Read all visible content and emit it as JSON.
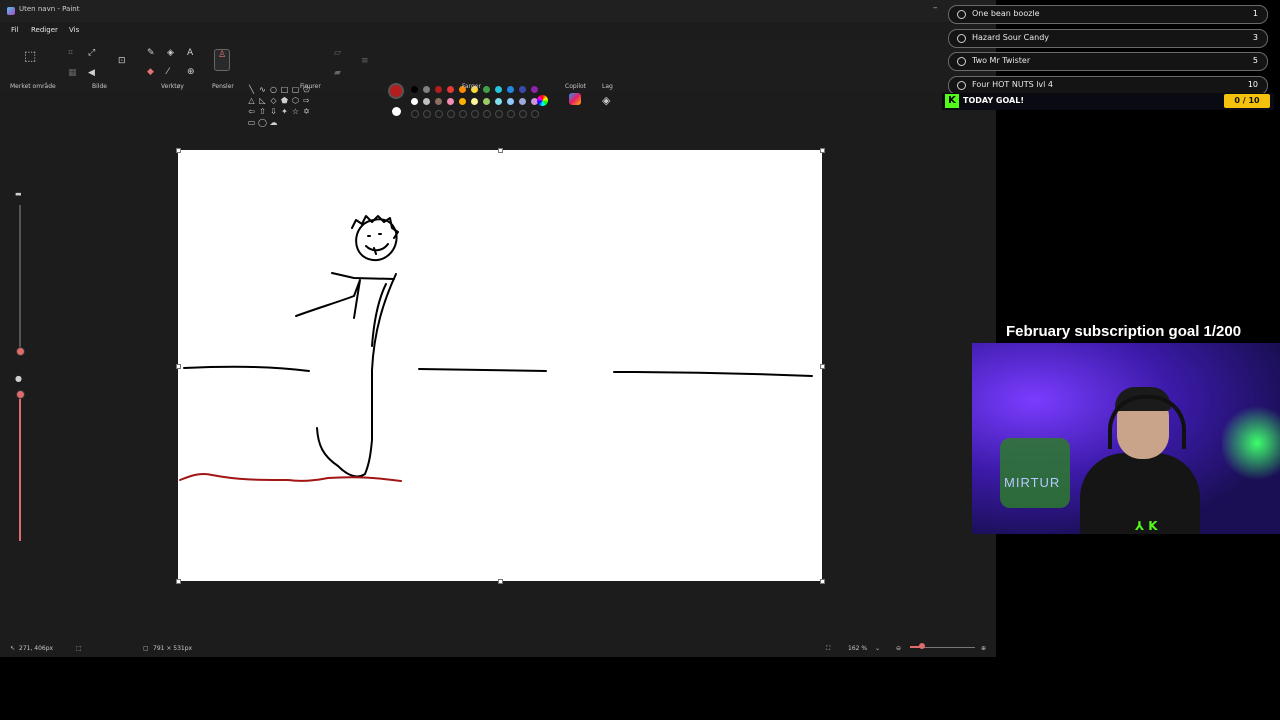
{
  "window": {
    "title": "Uten navn - Paint"
  },
  "menu": [
    "Fil",
    "Rediger",
    "Vis"
  ],
  "ribbon": {
    "groups": [
      "Merket område",
      "Bilde",
      "Verktøy",
      "Pensler",
      "Figurer",
      "Farger",
      "Copilot",
      "Lag"
    ]
  },
  "colors": {
    "primary": "#b21d1d",
    "secondary": "#ffffff",
    "palette_row1": [
      "#000000",
      "#808080",
      "#b21d1d",
      "#e53935",
      "#fb8c00",
      "#fdd835",
      "#43a047",
      "#26c6da",
      "#1e88e5",
      "#3949ab",
      "#8e24aa"
    ],
    "palette_row2": [
      "#ffffff",
      "#c0c0c0",
      "#8d6e63",
      "#f48fb1",
      "#ffb300",
      "#fff59d",
      "#9ccc65",
      "#80deea",
      "#90caf9",
      "#9fa8da",
      "#ce93d8"
    ]
  },
  "statusbar": {
    "cursor": "271, 406px",
    "size": "791 × 531px",
    "zoom": "162 %"
  },
  "overlay": {
    "goals": [
      {
        "name": "One bean boozle",
        "count": "1"
      },
      {
        "name": "Hazard Sour Candy",
        "count": "3"
      },
      {
        "name": "Two Mr Twister",
        "count": "5"
      },
      {
        "name": "Four HOT NUTS lvl 4",
        "count": "10"
      }
    ],
    "today_goal": {
      "label": "TODAY GOAL!",
      "count": "0 / 10"
    },
    "subscription_goal": "February subscription goal 1/200",
    "webcam_text": "MIRTUR"
  }
}
